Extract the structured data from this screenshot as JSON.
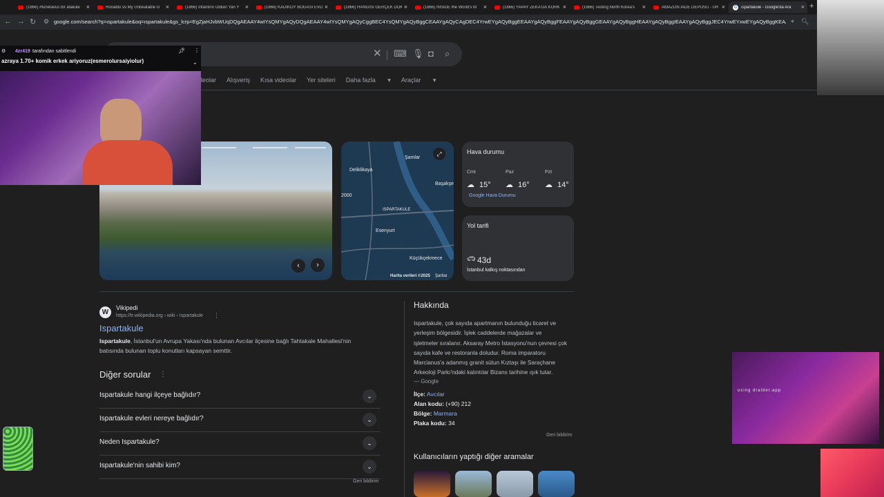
{
  "tabs": [
    {
      "label": "(1866) #tunetavus bir atakule",
      "icon": "youtube-icon"
    },
    {
      "label": "Ronaldo vs My Unbeatable G",
      "icon": "youtube-icon"
    },
    {
      "label": "(1866) Infantino Olduk! Yan Y",
      "icon": "youtube-icon"
    },
    {
      "label": "(1866) KADIKÖY BOĞASI EVD",
      "icon": "youtube-icon"
    },
    {
      "label": "(1866) HANGİSİ GERÇEK DOK",
      "icon": "youtube-icon"
    },
    {
      "label": "(1866) INSIDE the World's M",
      "icon": "youtube-icon"
    },
    {
      "label": "(1866) YAPAY ZEKA'DA KORK",
      "icon": "youtube-icon"
    },
    {
      "label": "(1866) Testing North Korea's",
      "icon": "youtube-icon"
    },
    {
      "label": "AMAZON İADE DEPOSU - ÜR",
      "icon": "youtube-icon"
    },
    {
      "label": "ıspartakule - Google'da Ara",
      "icon": "google-icon"
    }
  ],
  "address": {
    "url": "google.com/search?q=ıspartakule&oq=ıspartakule&gs_lcrp=EgZjaHJvbWUqDQgAEAAY4wIYsQMYgAQyDQgAEAAY4wIYsQMYgAQyCggBEC4YsQMYgAQyBggCEAAYgAQyCAgDEC4YrwEYgAQyBggEEAAYgAQyBggFEAAYgAQyBggGEAAYgAQyBggHEAAYgAQyBggIEAAYgAQyBggJEC4YrwEYxwEYgAQyBggKEAAYgAQyBggLEC4YxwEYrwEYgATSAQgxODAzajBqNGqCALACAA"
  },
  "search": {
    "query": ""
  },
  "nav_tabs": [
    "deolar",
    "Alışveriş",
    "Kısa videolar",
    "Yer siteleri",
    "Daha fazla",
    "Araçlar"
  ],
  "stream_pin": {
    "user": "4zr419",
    "by": "tarafından sabitlendi",
    "message": "azraya 1.70+ komik erkek ariyoruz(esmerolursaiyiolur)"
  },
  "map": {
    "labels": [
      "Şamlar",
      "Deliklikaya",
      "Başakşe",
      "2000",
      "ISPARTAKULE",
      "Esenyurt",
      "Küçükçekmece"
    ],
    "credit": "Harita verileri ©2025",
    "terms": "Şartlar"
  },
  "weather": {
    "title": "Hava durumu",
    "days": [
      {
        "day": "Cmt",
        "temp": "15°"
      },
      {
        "day": "Paz",
        "temp": "16°"
      },
      {
        "day": "Pzt",
        "temp": "14°"
      }
    ],
    "link": "Google Hava Durumu"
  },
  "route": {
    "title": "Yol tarifi",
    "time": "43d",
    "from": "İstanbul kalkış noktasından"
  },
  "result": {
    "site": "Vikipedi",
    "cite": "https://tr.wikipedia.org › wiki › Ispartakule",
    "title": "Ispartakule",
    "snippet_bold": "Ispartakule",
    "snippet": ", İstanbul'un Avrupa Yakası'nda bulunan Avcılar ilçesine bağlı Tahtakale Mahallesi'nin batısında bulunan toplu konutları kapsayan semttir."
  },
  "faq": {
    "title": "Diğer sorular",
    "items": [
      "Ispartakule hangi ilçeye bağlıdır?",
      "Ispartakule evleri nereye bağlıdır?",
      "Neden Ispartakule?",
      "Ispartakule'nin sahibi kim?"
    ],
    "feedback": "Geri bildirim"
  },
  "about": {
    "title": "Hakkında",
    "text": "Ispartakule, çok sayıda apartmanın bulunduğu ticaret ve yerleşim bölgesidir. İşlek caddelerde mağazalar ve işletmeler sıralanır. Aksaray Metro İstasyonu'nun çevresi çok sayıda kafe ve restoranla doludur. Roma imparatoru Marcianus'a adanmış granit sütun Kıztaşı ile Saraçhane Arkeoloji Parkı'ndaki kalıntılar Bizans tarihine ışık tutar.",
    "source": "— Google",
    "facts": [
      {
        "key": "İlçe:",
        "value": "Avcılar",
        "link": true
      },
      {
        "key": "Alan kodu:",
        "value": "(+90) 212",
        "link": false
      },
      {
        "key": "Bölge:",
        "value": "Marmara",
        "link": true
      },
      {
        "key": "Plaka kodu:",
        "value": "34",
        "link": false
      }
    ],
    "feedback": "Geri bildirim"
  },
  "related": {
    "title": "Kullanıcıların yaptığı diğer aramalar"
  },
  "cam2": {
    "caption": "using dralder.app"
  }
}
